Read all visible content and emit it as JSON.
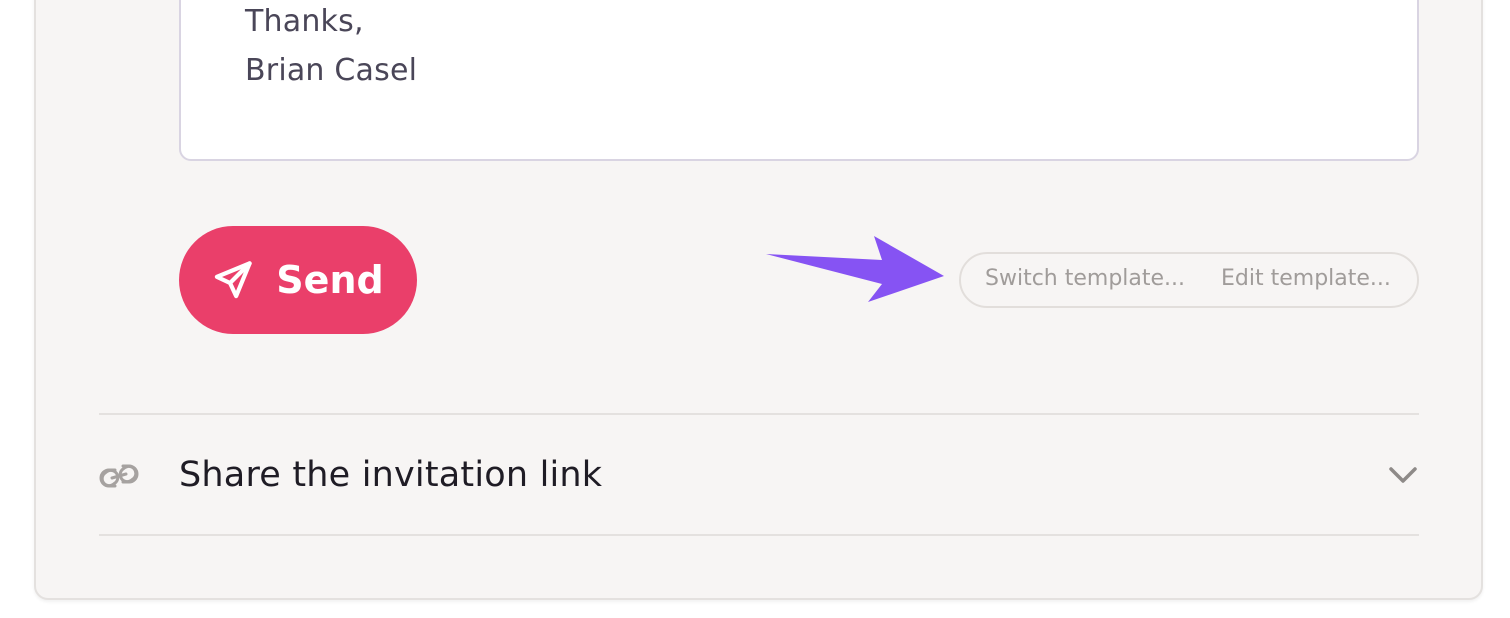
{
  "message": {
    "lines": [
      "Thanks,",
      "Brian Casel"
    ]
  },
  "actions": {
    "send_label": "Send",
    "send_icon": "paper-plane-icon",
    "switch_template_label": "Switch template...",
    "edit_template_label": "Edit template..."
  },
  "annotation": {
    "arrow_color": "#8653f3"
  },
  "share_section": {
    "icon": "link-icon",
    "title": "Share the invitation link",
    "expand_icon": "chevron-down-icon"
  },
  "colors": {
    "accent": "#ea3f6a",
    "card_background": "#f7f5f4",
    "muted_text": "#a09c9a"
  }
}
